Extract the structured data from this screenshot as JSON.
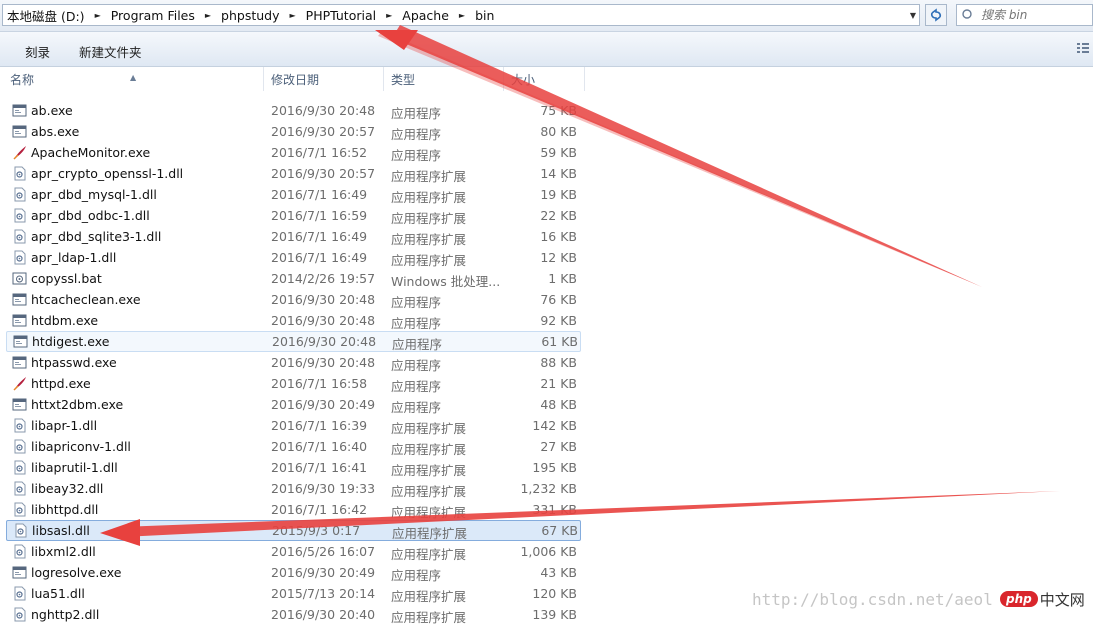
{
  "address": {
    "crumbs": [
      "本地磁盘 (D:)",
      "Program Files",
      "phpstudy",
      "PHPTutorial",
      "Apache",
      "bin"
    ],
    "search_placeholder": "搜索 bin"
  },
  "toolbar": {
    "burn_label": "刻录",
    "new_folder_label": "新建文件夹"
  },
  "columns": {
    "name": "名称",
    "date": "修改日期",
    "type": "类型",
    "size": "大小"
  },
  "files": [
    {
      "name": "ab.exe",
      "date": "2016/9/30 20:48",
      "type": "应用程序",
      "size": "75 KB",
      "icon": "exe-icon"
    },
    {
      "name": "abs.exe",
      "date": "2016/9/30 20:57",
      "type": "应用程序",
      "size": "80 KB",
      "icon": "exe-icon"
    },
    {
      "name": "ApacheMonitor.exe",
      "date": "2016/7/1 16:52",
      "type": "应用程序",
      "size": "59 KB",
      "icon": "apache-feather-icon"
    },
    {
      "name": "apr_crypto_openssl-1.dll",
      "date": "2016/9/30 20:57",
      "type": "应用程序扩展",
      "size": "14 KB",
      "icon": "dll-icon"
    },
    {
      "name": "apr_dbd_mysql-1.dll",
      "date": "2016/7/1 16:49",
      "type": "应用程序扩展",
      "size": "19 KB",
      "icon": "dll-icon"
    },
    {
      "name": "apr_dbd_odbc-1.dll",
      "date": "2016/7/1 16:59",
      "type": "应用程序扩展",
      "size": "22 KB",
      "icon": "dll-icon"
    },
    {
      "name": "apr_dbd_sqlite3-1.dll",
      "date": "2016/7/1 16:49",
      "type": "应用程序扩展",
      "size": "16 KB",
      "icon": "dll-icon"
    },
    {
      "name": "apr_ldap-1.dll",
      "date": "2016/7/1 16:49",
      "type": "应用程序扩展",
      "size": "12 KB",
      "icon": "dll-icon"
    },
    {
      "name": "copyssl.bat",
      "date": "2014/2/26 19:57",
      "type": "Windows 批处理...",
      "size": "1 KB",
      "icon": "bat-icon"
    },
    {
      "name": "htcacheclean.exe",
      "date": "2016/9/30 20:48",
      "type": "应用程序",
      "size": "76 KB",
      "icon": "exe-icon"
    },
    {
      "name": "htdbm.exe",
      "date": "2016/9/30 20:48",
      "type": "应用程序",
      "size": "92 KB",
      "icon": "exe-icon"
    },
    {
      "name": "htdigest.exe",
      "date": "2016/9/30 20:48",
      "type": "应用程序",
      "size": "61 KB",
      "icon": "exe-icon",
      "state": "hover"
    },
    {
      "name": "htpasswd.exe",
      "date": "2016/9/30 20:48",
      "type": "应用程序",
      "size": "88 KB",
      "icon": "exe-icon"
    },
    {
      "name": "httpd.exe",
      "date": "2016/7/1 16:58",
      "type": "应用程序",
      "size": "21 KB",
      "icon": "apache-feather-icon"
    },
    {
      "name": "httxt2dbm.exe",
      "date": "2016/9/30 20:49",
      "type": "应用程序",
      "size": "48 KB",
      "icon": "exe-icon"
    },
    {
      "name": "libapr-1.dll",
      "date": "2016/7/1 16:39",
      "type": "应用程序扩展",
      "size": "142 KB",
      "icon": "dll-icon"
    },
    {
      "name": "libapriconv-1.dll",
      "date": "2016/7/1 16:40",
      "type": "应用程序扩展",
      "size": "27 KB",
      "icon": "dll-icon"
    },
    {
      "name": "libaprutil-1.dll",
      "date": "2016/7/1 16:41",
      "type": "应用程序扩展",
      "size": "195 KB",
      "icon": "dll-icon"
    },
    {
      "name": "libeay32.dll",
      "date": "2016/9/30 19:33",
      "type": "应用程序扩展",
      "size": "1,232 KB",
      "icon": "dll-icon"
    },
    {
      "name": "libhttpd.dll",
      "date": "2016/7/1 16:42",
      "type": "应用程序扩展",
      "size": "331 KB",
      "icon": "dll-icon"
    },
    {
      "name": "libsasl.dll",
      "date": "2015/9/3 0:17",
      "type": "应用程序扩展",
      "size": "67 KB",
      "icon": "dll-icon",
      "state": "selected"
    },
    {
      "name": "libxml2.dll",
      "date": "2016/5/26 16:07",
      "type": "应用程序扩展",
      "size": "1,006 KB",
      "icon": "dll-icon"
    },
    {
      "name": "logresolve.exe",
      "date": "2016/9/30 20:49",
      "type": "应用程序",
      "size": "43 KB",
      "icon": "exe-icon"
    },
    {
      "name": "lua51.dll",
      "date": "2015/7/13 20:14",
      "type": "应用程序扩展",
      "size": "120 KB",
      "icon": "dll-icon"
    },
    {
      "name": "nghttp2.dll",
      "date": "2016/9/30 20:40",
      "type": "应用程序扩展",
      "size": "139 KB",
      "icon": "dll-icon"
    }
  ],
  "watermark": {
    "url_text": "http://blog.csdn.net/aeol",
    "logo_php": "php",
    "logo_cn": "中文网"
  },
  "colors": {
    "arrow": "#e8413e",
    "selection": "#dbe9f9",
    "selection_border": "#84acdd"
  }
}
